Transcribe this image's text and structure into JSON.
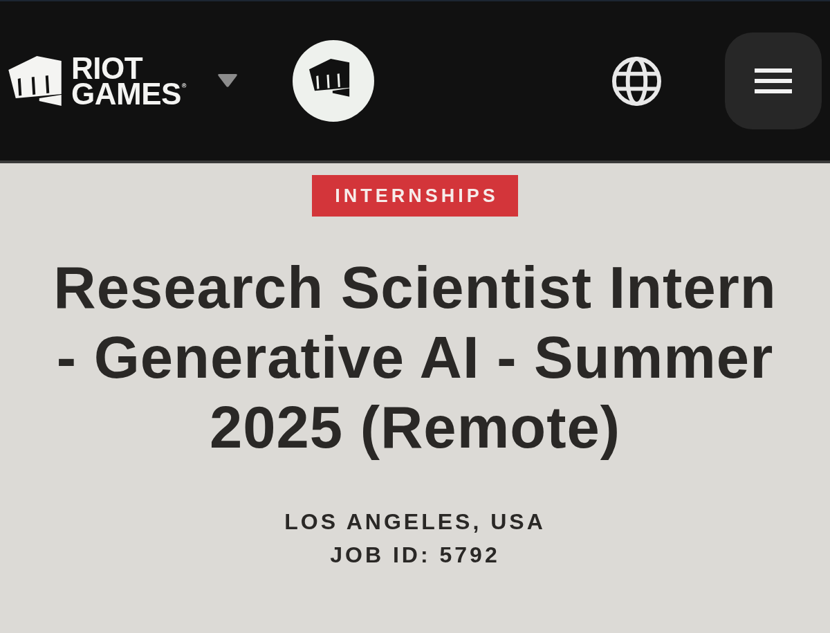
{
  "header": {
    "logo": {
      "wordmark": [
        "RIOT",
        "GAMES"
      ],
      "trademark": "®"
    }
  },
  "job": {
    "category": "INTERNSHIPS",
    "title": "Research Scientist Intern - Generative AI - Summer 2025 (Remote)",
    "location": "LOS ANGELES, USA",
    "job_id": "JOB ID: 5792"
  }
}
